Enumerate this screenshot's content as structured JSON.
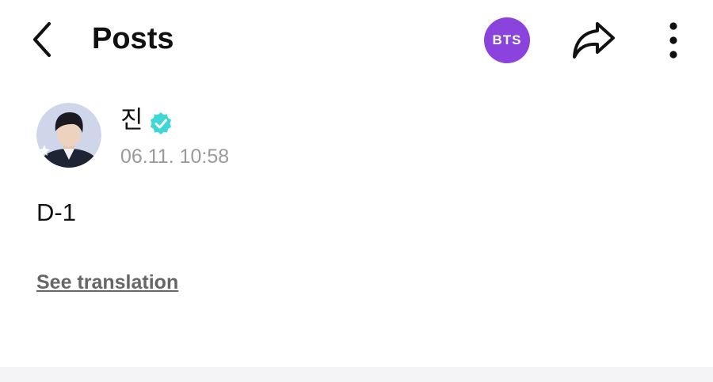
{
  "header": {
    "title": "Posts",
    "back_icon": "chevron-left-icon",
    "community_badge_label": "BTS",
    "community_badge_color": "#8a43dd",
    "share_icon": "share-arrow-icon",
    "more_icon": "more-vertical-icon"
  },
  "post": {
    "author": {
      "name": "진",
      "verified": true,
      "verified_color": "#3ed6d6",
      "avatar_icon": "profile-avatar"
    },
    "timestamp": "06.11. 10:58",
    "body": "D-1",
    "translation_link": "See translation"
  }
}
